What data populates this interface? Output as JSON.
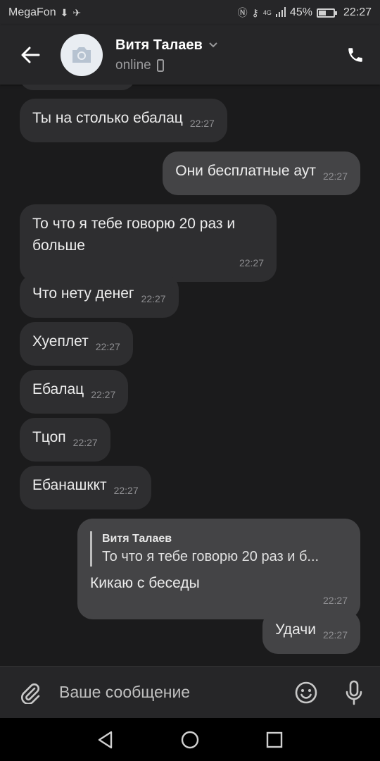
{
  "status_bar": {
    "carrier": "MegaFon",
    "network": "4G",
    "battery": "45%",
    "time": "22:27"
  },
  "header": {
    "contact_name": "Витя Талаев",
    "presence": "online"
  },
  "messages": [
    {
      "text": "Ты на столько ебалац",
      "time": "22:27",
      "direction": "in"
    },
    {
      "text": "Они бесплатные аут",
      "time": "22:27",
      "direction": "out"
    },
    {
      "text": "То что я тебе говорю 20 раз и больше",
      "time": "22:27",
      "direction": "in"
    },
    {
      "text": "Что нету денег",
      "time": "22:27",
      "direction": "in"
    },
    {
      "text": "Хуеплет",
      "time": "22:27",
      "direction": "in"
    },
    {
      "text": "Ебалац",
      "time": "22:27",
      "direction": "in"
    },
    {
      "text": "Тцоп",
      "time": "22:27",
      "direction": "in"
    },
    {
      "text": "Ебанашккт",
      "time": "22:27",
      "direction": "in"
    },
    {
      "reply_author": "Витя Талаев",
      "reply_text": "То что я тебе говорю 20 раз и б...",
      "text": "Кикаю с беседы",
      "time": "22:27",
      "direction": "out"
    },
    {
      "text": "Удачи",
      "time": "22:27",
      "direction": "out"
    }
  ],
  "composer": {
    "placeholder": "Ваше сообщение"
  },
  "icons": {
    "back": "arrow-back-icon",
    "avatar": "camera-icon",
    "phone": "phone-icon",
    "attach": "paperclip-icon",
    "emoji": "emoji-icon",
    "mic": "microphone-icon"
  },
  "colors": {
    "background": "#1b1b1c",
    "bar": "#262628",
    "incoming_bubble": "#2e2e30",
    "outgoing_bubble": "#444446"
  }
}
